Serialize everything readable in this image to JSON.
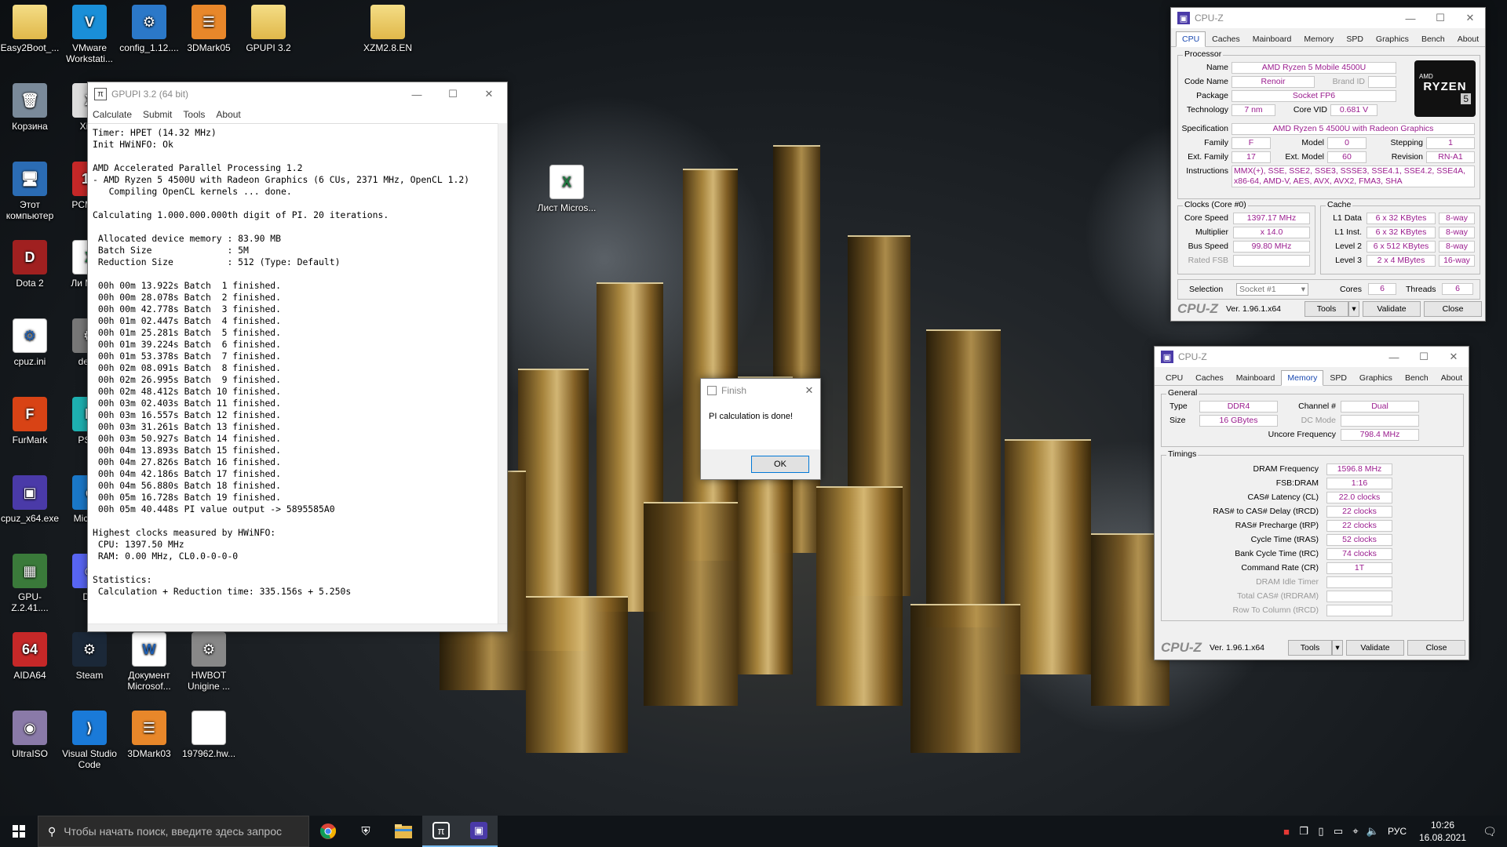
{
  "desktop": {
    "icons": [
      {
        "label": "Easy2Boot_...",
        "glyph": "",
        "kind": "folder"
      },
      {
        "label": "VMware Workstati...",
        "glyph": "V",
        "kind": "app",
        "color": "#1a8fd8"
      },
      {
        "label": "config_1.12....",
        "glyph": "⚙",
        "kind": "app",
        "color": "#2b78c8"
      },
      {
        "label": "3DMark05",
        "glyph": "☰",
        "kind": "app",
        "color": "#e8872a"
      },
      {
        "label": "GPUPI 3.2",
        "glyph": "",
        "kind": "folder"
      },
      {
        "label": "XZM2.8.EN",
        "glyph": "",
        "kind": "folder"
      },
      {
        "label": "Корзина",
        "glyph": "🗑",
        "kind": "app",
        "color": "#7a8a9a"
      },
      {
        "label": "XinZ",
        "glyph": "X",
        "kind": "app",
        "color": "#ddd"
      },
      {
        "label": "Этот компьютер",
        "glyph": "🖥",
        "kind": "app",
        "color": "#2b6cb4"
      },
      {
        "label": "PCM De",
        "glyph": "10",
        "kind": "app",
        "color": "#c62828"
      },
      {
        "label": "Dota 2",
        "glyph": "D",
        "kind": "app",
        "color": "#a02020"
      },
      {
        "label": "Ли Micro",
        "glyph": "X",
        "kind": "xls"
      },
      {
        "label": "cpuz.ini",
        "glyph": "⚙",
        "kind": "doc"
      },
      {
        "label": "deskt",
        "glyph": "⚙",
        "kind": "app",
        "color": "#777"
      },
      {
        "label": "FurMark",
        "glyph": "F",
        "kind": "app",
        "color": "#d84315"
      },
      {
        "label": "PSIM",
        "glyph": "P",
        "kind": "app",
        "color": "#1eb0b0"
      },
      {
        "label": "cpuz_x64.exe",
        "glyph": "▣",
        "kind": "app",
        "color": "#4a3aa8"
      },
      {
        "label": "Micr Ed",
        "glyph": "e",
        "kind": "app",
        "color": "#1a78c8"
      },
      {
        "label": "GPU-Z.2.41....",
        "glyph": "▦",
        "kind": "app",
        "color": "#3a7a3a"
      },
      {
        "label": "Dis",
        "glyph": "☺",
        "kind": "app",
        "color": "#5865f2"
      },
      {
        "label": "AIDA64",
        "glyph": "64",
        "kind": "app",
        "color": "#c62828"
      },
      {
        "label": "Steam",
        "glyph": "⚙",
        "kind": "app",
        "color": "#1b2838"
      },
      {
        "label": "Документ Microsof...",
        "glyph": "W",
        "kind": "doc"
      },
      {
        "label": "HWBOT Unigine ...",
        "glyph": "⚙",
        "kind": "app",
        "color": "#888"
      },
      {
        "label": "UltraISO",
        "glyph": "◉",
        "kind": "app",
        "color": "#8a7aa8"
      },
      {
        "label": "Visual Studio Code",
        "glyph": "⟩",
        "kind": "app",
        "color": "#1a7ad8"
      },
      {
        "label": "3DMark03",
        "glyph": "☰",
        "kind": "app",
        "color": "#e8872a"
      },
      {
        "label": "197962.hw...",
        "glyph": "",
        "kind": "doc"
      },
      {
        "label": "Лист Micros...",
        "glyph": "X",
        "kind": "xls"
      }
    ]
  },
  "gpupi": {
    "title": "GPUPI 3.2 (64 bit)",
    "menu": [
      "Calculate",
      "Submit",
      "Tools",
      "About"
    ],
    "lines": [
      "Timer: HPET (14.32 MHz)",
      "Init HWiNFO: Ok",
      "",
      "AMD Accelerated Parallel Processing 1.2",
      "- AMD Ryzen 5 4500U with Radeon Graphics (6 CUs, 2371 MHz, OpenCL 1.2)",
      "   Compiling OpenCL kernels ... done.",
      "",
      "Calculating 1.000.000.000th digit of PI. 20 iterations.",
      "",
      " Allocated device memory : 83.90 MB",
      " Batch Size              : 5M",
      " Reduction Size          : 512 (Type: Default)",
      "",
      " 00h 00m 13.922s Batch  1 finished.",
      " 00h 00m 28.078s Batch  2 finished.",
      " 00h 00m 42.778s Batch  3 finished.",
      " 00h 01m 02.447s Batch  4 finished.",
      " 00h 01m 25.281s Batch  5 finished.",
      " 00h 01m 39.224s Batch  6 finished.",
      " 00h 01m 53.378s Batch  7 finished.",
      " 00h 02m 08.091s Batch  8 finished.",
      " 00h 02m 26.995s Batch  9 finished.",
      " 00h 02m 48.412s Batch 10 finished.",
      " 00h 03m 02.403s Batch 11 finished.",
      " 00h 03m 16.557s Batch 12 finished.",
      " 00h 03m 31.261s Batch 13 finished.",
      " 00h 03m 50.927s Batch 14 finished.",
      " 00h 04m 13.893s Batch 15 finished.",
      " 00h 04m 27.826s Batch 16 finished.",
      " 00h 04m 42.186s Batch 17 finished.",
      " 00h 04m 56.880s Batch 18 finished.",
      " 00h 05m 16.728s Batch 19 finished.",
      " 00h 05m 40.448s PI value output -> 5895585A0",
      "",
      "Highest clocks measured by HWiNFO:",
      " CPU: 1397.50 MHz",
      " RAM: 0.00 MHz, CL0.0-0-0-0",
      "",
      "Statistics:",
      " Calculation + Reduction time: 335.156s + 5.250s"
    ]
  },
  "finish_dialog": {
    "title": "Finish",
    "message": "PI calculation is done!",
    "ok_label": "OK"
  },
  "cpuz_cpu": {
    "title": "CPU-Z",
    "tabs": [
      "CPU",
      "Caches",
      "Mainboard",
      "Memory",
      "SPD",
      "Graphics",
      "Bench",
      "About"
    ],
    "active_tab": "CPU",
    "processor_group": "Processor",
    "name_label": "Name",
    "name": "AMD Ryzen 5 Mobile 4500U",
    "codename_label": "Code Name",
    "codename": "Renoir",
    "brandid_label": "Brand ID",
    "brandid": "",
    "package_label": "Package",
    "package": "Socket FP6",
    "technology_label": "Technology",
    "technology": "7 nm",
    "corevid_label": "Core VID",
    "corevid": "0.681 V",
    "spec_label": "Specification",
    "spec": "AMD Ryzen 5 4500U with Radeon Graphics",
    "family_label": "Family",
    "family": "F",
    "model_label": "Model",
    "model": "0",
    "stepping_label": "Stepping",
    "stepping": "1",
    "extfamily_label": "Ext. Family",
    "extfamily": "17",
    "extmodel_label": "Ext. Model",
    "extmodel": "60",
    "revision_label": "Revision",
    "revision": "RN-A1",
    "instructions_label": "Instructions",
    "instructions": "MMX(+), SSE, SSE2, SSE3, SSSE3, SSE4.1, SSE4.2, SSE4A, x86-64, AMD-V, AES, AVX, AVX2, FMA3, SHA",
    "logo_brand": "AMD",
    "logo_line": "RYZEN",
    "logo_num": "5",
    "clocks_group": "Clocks (Core #0)",
    "corespeed_label": "Core Speed",
    "corespeed": "1397.17 MHz",
    "multiplier_label": "Multiplier",
    "multiplier": "x 14.0",
    "busspeed_label": "Bus Speed",
    "busspeed": "99.80 MHz",
    "ratedfsb_label": "Rated FSB",
    "ratedfsb": "",
    "cache_group": "Cache",
    "l1d_label": "L1 Data",
    "l1d": "6 x 32 KBytes",
    "l1d_way": "8-way",
    "l1i_label": "L1 Inst.",
    "l1i": "6 x 32 KBytes",
    "l1i_way": "8-way",
    "l2_label": "Level 2",
    "l2": "6 x 512 KBytes",
    "l2_way": "8-way",
    "l3_label": "Level 3",
    "l3": "2 x 4 MBytes",
    "l3_way": "16-way",
    "selection_label": "Selection",
    "selection": "Socket #1",
    "cores_label": "Cores",
    "cores": "6",
    "threads_label": "Threads",
    "threads": "6",
    "footer_logo": "CPU-Z",
    "version": "Ver. 1.96.1.x64",
    "tools_label": "Tools",
    "validate_label": "Validate",
    "close_label": "Close"
  },
  "cpuz_mem": {
    "title": "CPU-Z",
    "tabs": [
      "CPU",
      "Caches",
      "Mainboard",
      "Memory",
      "SPD",
      "Graphics",
      "Bench",
      "About"
    ],
    "active_tab": "Memory",
    "general_group": "General",
    "type_label": "Type",
    "type": "DDR4",
    "size_label": "Size",
    "size": "16 GBytes",
    "channel_label": "Channel #",
    "channel": "Dual",
    "dcmode_label": "DC Mode",
    "dcmode": "",
    "uncore_label": "Uncore Frequency",
    "uncore": "798.4 MHz",
    "timings_group": "Timings",
    "timings": [
      {
        "label": "DRAM Frequency",
        "value": "1596.8 MHz",
        "dim": false
      },
      {
        "label": "FSB:DRAM",
        "value": "1:16",
        "dim": false
      },
      {
        "label": "CAS# Latency (CL)",
        "value": "22.0 clocks",
        "dim": false
      },
      {
        "label": "RAS# to CAS# Delay (tRCD)",
        "value": "22 clocks",
        "dim": false
      },
      {
        "label": "RAS# Precharge (tRP)",
        "value": "22 clocks",
        "dim": false
      },
      {
        "label": "Cycle Time (tRAS)",
        "value": "52 clocks",
        "dim": false
      },
      {
        "label": "Bank Cycle Time (tRC)",
        "value": "74 clocks",
        "dim": false
      },
      {
        "label": "Command Rate (CR)",
        "value": "1T",
        "dim": false
      },
      {
        "label": "DRAM Idle Timer",
        "value": "",
        "dim": true
      },
      {
        "label": "Total CAS# (tRDRAM)",
        "value": "",
        "dim": true
      },
      {
        "label": "Row To Column (tRCD)",
        "value": "",
        "dim": true
      }
    ],
    "footer_logo": "CPU-Z",
    "version": "Ver. 1.96.1.x64",
    "tools_label": "Tools",
    "validate_label": "Validate",
    "close_label": "Close"
  },
  "taskbar": {
    "search_placeholder": "Чтобы начать поиск, введите здесь запрос",
    "language": "РУС",
    "time": "10:26",
    "date": "16.08.2021"
  },
  "colors": {
    "cpuz_value": "#9a1c8e",
    "taskbar": "#101418",
    "accent": "#0078d7"
  }
}
